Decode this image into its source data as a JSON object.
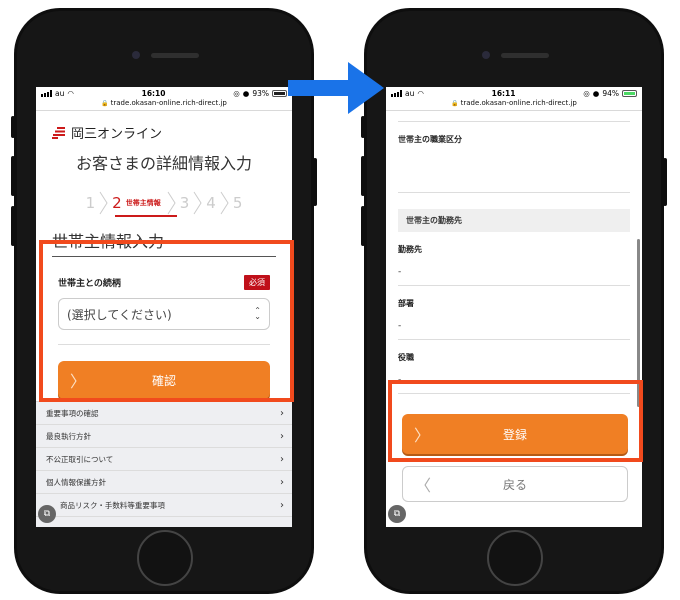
{
  "colors": {
    "accent_orange": "#f07f24",
    "brand_red": "#cc1a1a",
    "highlight": "#f14a1d",
    "arrow_blue": "#1a73e8"
  },
  "left": {
    "status": {
      "carrier": "au",
      "time": "16:10",
      "battery": "93%"
    },
    "url": "trade.okasan-online.rich-direct.jp",
    "brand": "岡三オンライン",
    "title": "お客さまの詳細情報入力",
    "steps": {
      "s1": "1",
      "s2": "2",
      "s2_caption": "世帯主情報",
      "s3": "3",
      "s4": "4",
      "s5": "5"
    },
    "section_title": "世帯主情報入力",
    "field_label": "世帯主との続柄",
    "required_badge": "必須",
    "select_value": "(選択してください)",
    "confirm_button": "確認",
    "footer_links": [
      "重要事項の確認",
      "最良執行方針",
      "不公正取引について",
      "個人情報保護方針",
      "商品リスク・手数料等重要事項"
    ]
  },
  "right": {
    "status": {
      "carrier": "au",
      "time": "16:11",
      "battery": "94%"
    },
    "url": "trade.okasan-online.rich-direct.jp",
    "occupation_label": "世帯主の職業区分",
    "employer_section": "世帯主の勤務先",
    "fields": [
      {
        "label": "勤務先",
        "value": "-"
      },
      {
        "label": "部署",
        "value": "-"
      },
      {
        "label": "役職",
        "value": "-"
      }
    ],
    "register_button": "登録",
    "back_button": "戻る"
  }
}
